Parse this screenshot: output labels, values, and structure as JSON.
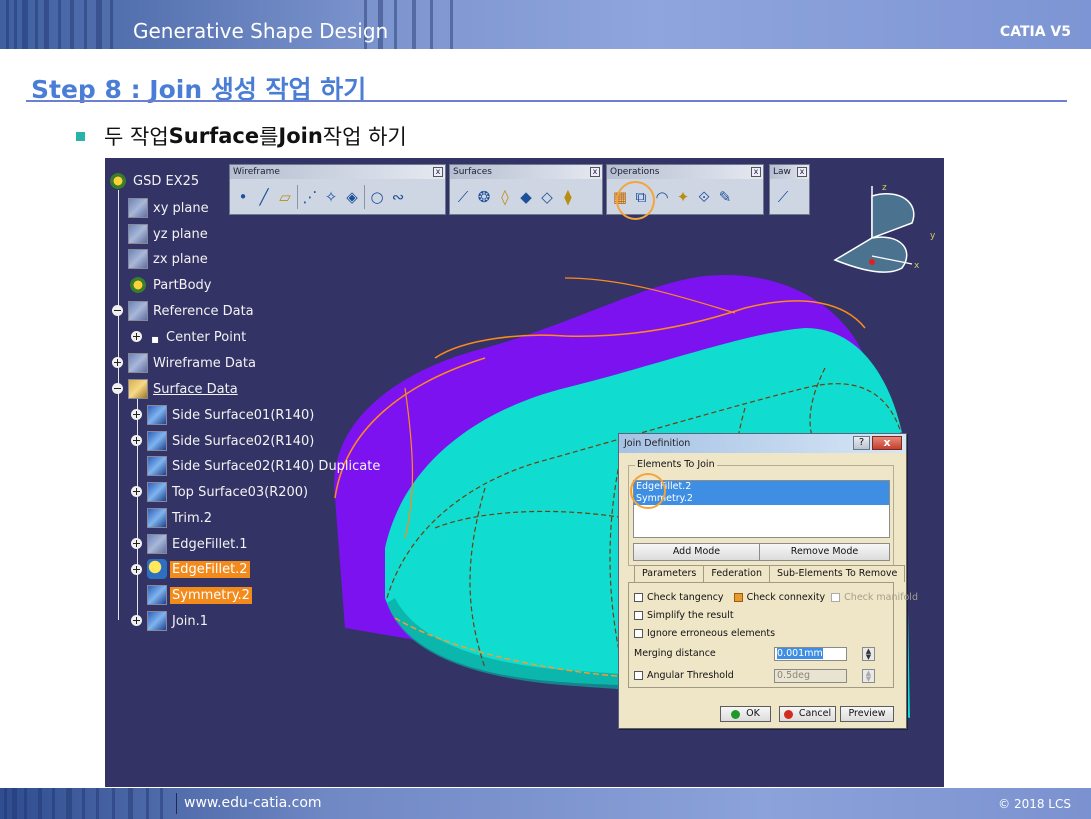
{
  "header": {
    "title": "Generative Shape Design",
    "brand": "CATIA V5"
  },
  "step": {
    "title": "Step 8 : Join 생성 작업 하기"
  },
  "bullet": {
    "prefix": "두 작업 ",
    "bold1": "Surface",
    "mid": "를 ",
    "bold2": "Join",
    "suffix": " 작업 하기"
  },
  "tree": {
    "root": "GSD EX25",
    "items": [
      {
        "label": "xy plane"
      },
      {
        "label": "yz plane"
      },
      {
        "label": "zx plane"
      },
      {
        "label": "PartBody"
      },
      {
        "label": "Reference Data"
      },
      {
        "label": "Center Point"
      },
      {
        "label": "Wireframe Data"
      },
      {
        "label": "Surface Data"
      },
      {
        "label": "Side Surface01(R140)"
      },
      {
        "label": "Side Surface02(R140)"
      },
      {
        "label": "Side Surface02(R140) Duplicate"
      },
      {
        "label": "Top Surface03(R200)"
      },
      {
        "label": "Trim.2"
      },
      {
        "label": "EdgeFillet.1"
      },
      {
        "label": "EdgeFillet.2"
      },
      {
        "label": "Symmetry.2"
      },
      {
        "label": "Join.1"
      }
    ]
  },
  "toolbars": {
    "wireframe": "Wireframe",
    "surfaces": "Surfaces",
    "operations": "Operations",
    "law": "Law",
    "close_glyph": "x"
  },
  "compass": {
    "z": "z",
    "y": "y",
    "x": "x"
  },
  "dialog": {
    "title": "Join Definition",
    "help": "?",
    "close": "x",
    "elements_group": "Elements To Join",
    "elements": [
      "EdgeFillet.2",
      "Symmetry.2"
    ],
    "add_mode": "Add Mode",
    "remove_mode": "Remove Mode",
    "tabs": [
      "Parameters",
      "Federation",
      "Sub-Elements To Remove"
    ],
    "check_tangency": "Check tangency",
    "check_connexity": "Check connexity",
    "check_manifold": "Check manifold",
    "simplify": "Simplify the result",
    "ignore": "Ignore erroneous elements",
    "merging_label": "Merging distance",
    "merging_value": "0.001mm",
    "angular_label": "Angular Threshold",
    "angular_value": "0.5deg",
    "ok": "OK",
    "cancel": "Cancel",
    "preview": "Preview"
  },
  "footer": {
    "url": "www.edu-catia.com",
    "copyright": "© 2018 LCS"
  },
  "colors": {
    "background": "#333366",
    "highlight": "#f28a1c",
    "selection": "#3e8ee3",
    "accent": "#4a7ed6"
  }
}
